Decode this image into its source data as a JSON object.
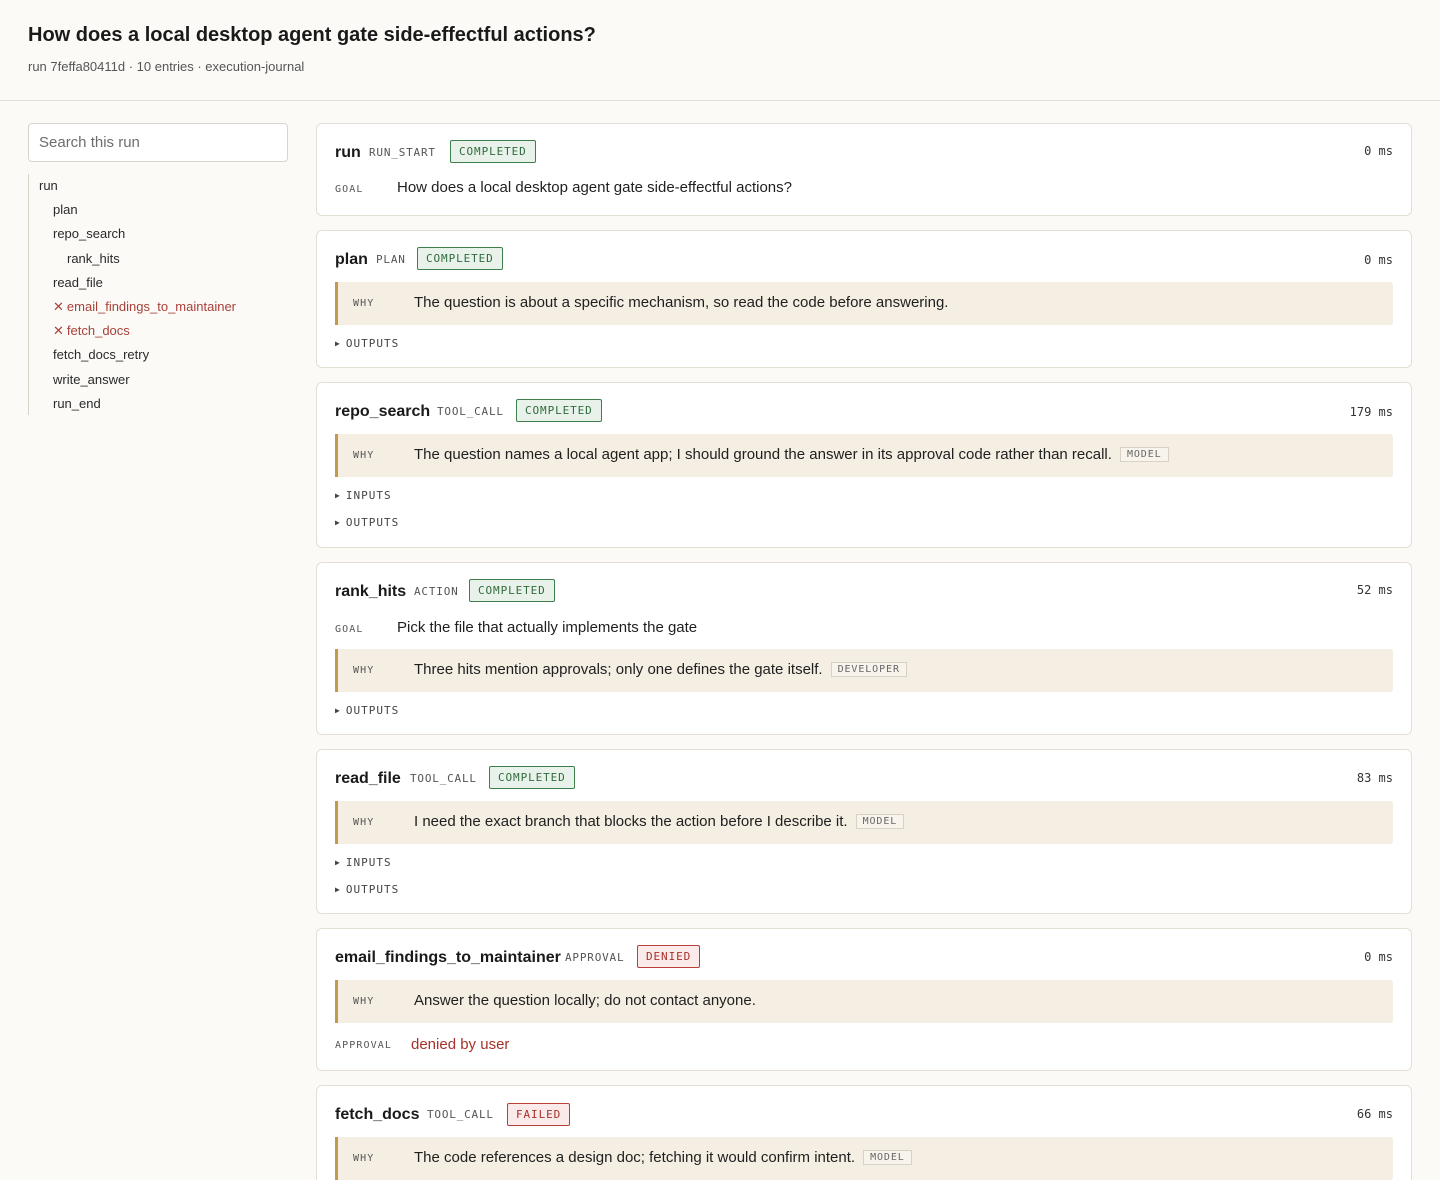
{
  "header": {
    "title": "How does a local desktop agent gate side-effectful actions?",
    "meta": "run 7feffa80411d · 10 entries · execution-journal"
  },
  "search": {
    "placeholder": "Search this run"
  },
  "tree": [
    {
      "label": "run",
      "depth": 0,
      "failed": false
    },
    {
      "label": "plan",
      "depth": 1,
      "failed": false
    },
    {
      "label": "repo_search",
      "depth": 1,
      "failed": false
    },
    {
      "label": "rank_hits",
      "depth": 2,
      "failed": false
    },
    {
      "label": "read_file",
      "depth": 1,
      "failed": false
    },
    {
      "label": "email_findings_to_maintainer",
      "depth": 1,
      "failed": true
    },
    {
      "label": "fetch_docs",
      "depth": 1,
      "failed": true
    },
    {
      "label": "fetch_docs_retry",
      "depth": 1,
      "failed": false
    },
    {
      "label": "write_answer",
      "depth": 1,
      "failed": false
    },
    {
      "label": "run_end",
      "depth": 1,
      "failed": false
    }
  ],
  "fail_mark": "✕",
  "labels": {
    "goal": "GOAL",
    "why": "WHY",
    "inputs": "INPUTS",
    "outputs": "OUTPUTS",
    "approval": "APPROVAL"
  },
  "cards": {
    "run": {
      "name": "run",
      "kind": "RUN_START",
      "status": "COMPLETED",
      "duration": "0 ms",
      "goal": "How does a local desktop agent gate side-effectful actions?"
    },
    "plan": {
      "name": "plan",
      "kind": "PLAN",
      "status": "COMPLETED",
      "duration": "0 ms",
      "why": "The question is about a specific mechanism, so read the code before answering."
    },
    "repo_search": {
      "name": "repo_search",
      "kind": "TOOL_CALL",
      "status": "COMPLETED",
      "duration": "179 ms",
      "why": "The question names a local agent app; I should ground the answer in its approval code rather than recall.",
      "why_source": "MODEL"
    },
    "rank_hits": {
      "name": "rank_hits",
      "kind": "ACTION",
      "status": "COMPLETED",
      "duration": "52 ms",
      "goal": "Pick the file that actually implements the gate",
      "why": "Three hits mention approvals; only one defines the gate itself.",
      "why_source": "DEVELOPER"
    },
    "read_file": {
      "name": "read_file",
      "kind": "TOOL_CALL",
      "status": "COMPLETED",
      "duration": "83 ms",
      "why": "I need the exact branch that blocks the action before I describe it.",
      "why_source": "MODEL"
    },
    "email": {
      "name": "email_findings_to_maintainer",
      "kind": "APPROVAL",
      "status": "DENIED",
      "duration": "0 ms",
      "why": "Answer the question locally; do not contact anyone.",
      "approval": "denied by user"
    },
    "fetch_docs": {
      "name": "fetch_docs",
      "kind": "TOOL_CALL",
      "status": "FAILED",
      "duration": "66 ms",
      "why": "The code references a design doc; fetching it would confirm intent.",
      "why_source": "MODEL"
    }
  },
  "colors": {
    "completed": "#2f6b3d",
    "failed": "#a8302a",
    "why_accent": "#c29a4e",
    "why_bg": "#f4eee3"
  }
}
